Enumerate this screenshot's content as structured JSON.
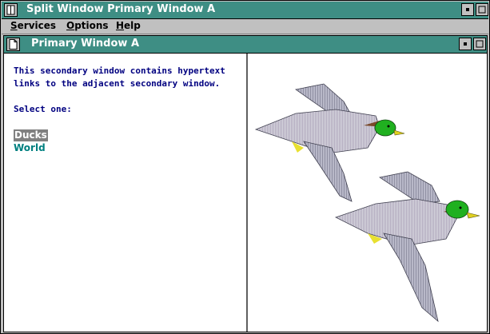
{
  "window": {
    "title": "Split Window Primary Window A",
    "buttons": [
      "minimize",
      "maximize"
    ]
  },
  "menu": {
    "items": [
      {
        "label": "Services",
        "mnemonic": "S",
        "rest": "ervices"
      },
      {
        "label": "Options",
        "mnemonic": "O",
        "rest": "ptions"
      },
      {
        "label": "Help",
        "mnemonic": "H",
        "rest": "elp"
      }
    ]
  },
  "document": {
    "title": "Primary Window A"
  },
  "left_pane": {
    "line1": "This secondary window contains hypertext",
    "line2": "links to the adjacent secondary window.",
    "prompt": "Select one:",
    "links": [
      {
        "label": "Ducks",
        "selected": true
      },
      {
        "label": "World",
        "selected": false
      }
    ]
  },
  "right_pane": {
    "image": "two-flying-mallard-ducks"
  },
  "colors": {
    "titlebar": "#3e8e84",
    "text": "#000080",
    "link": "#008080",
    "link_selected_bg": "#808080",
    "chrome": "#c0c0c0"
  }
}
